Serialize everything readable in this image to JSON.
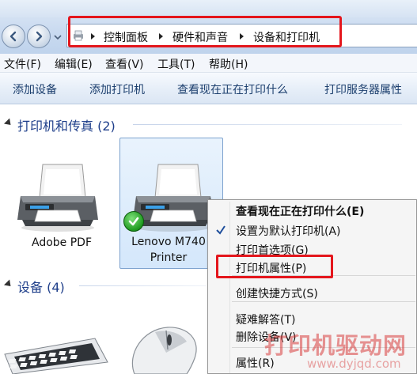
{
  "address_bar": {
    "crumbs": [
      "控制面板",
      "硬件和声音",
      "设备和打印机"
    ]
  },
  "menu": {
    "items": [
      "文件(F)",
      "编辑(E)",
      "查看(V)",
      "工具(T)",
      "帮助(H)"
    ]
  },
  "commands": {
    "items": [
      "添加设备",
      "添加打印机",
      "查看现在正在打印什么",
      "打印服务器属性"
    ]
  },
  "groups": {
    "printers": {
      "title": "打印机和传真 (2)"
    },
    "devices": {
      "title": "设备 (4)"
    }
  },
  "devices": {
    "adobe": {
      "label": "Adobe PDF"
    },
    "lenovo": {
      "label_line1": "Lenovo M740",
      "label_line2": "Printer",
      "default": true
    }
  },
  "context_menu": {
    "items": [
      {
        "label": "查看现在正在打印什么(E)",
        "bold": true
      },
      {
        "label": "设置为默认打印机(A)",
        "checked": true
      },
      {
        "label": "打印首选项(G)"
      },
      {
        "label": "打印机属性(P)"
      },
      {
        "label": "创建快捷方式(S)"
      },
      {
        "label": "疑难解答(T)"
      },
      {
        "label": "删除设备(V)"
      },
      {
        "label": "属性(R)"
      }
    ]
  },
  "watermark": {
    "text": "打印机驱动网",
    "url": "www.dyjqd.com"
  },
  "colors": {
    "highlight_box": "#e4161c",
    "group_title": "#1e3e8a",
    "command_text": "#1c3f6e"
  }
}
